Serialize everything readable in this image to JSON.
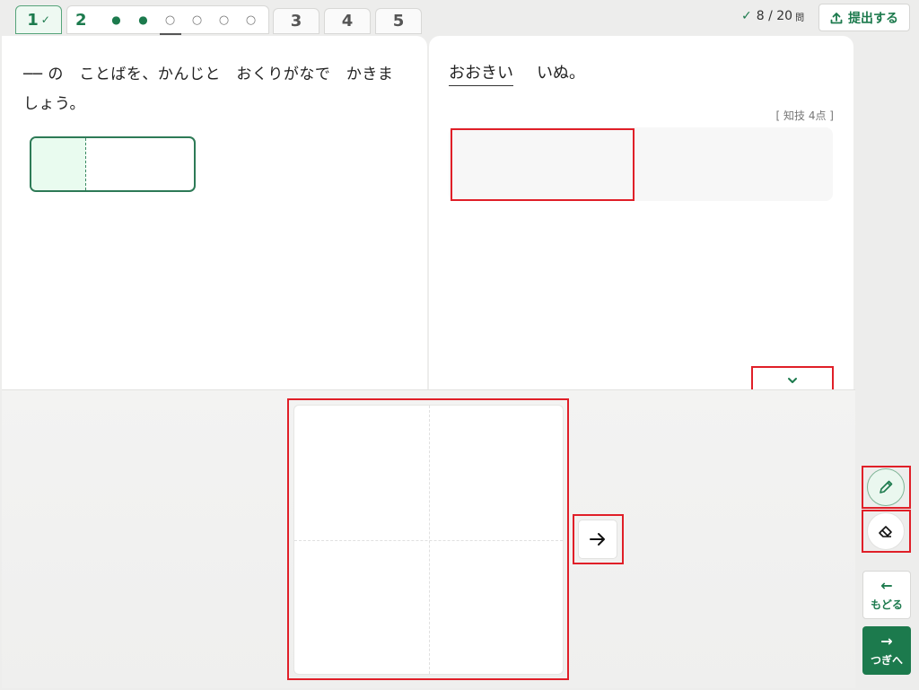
{
  "tabs": {
    "tab1_label": "1",
    "tab1_check": "✓",
    "tab2_label": "2",
    "tab3_label": "3",
    "tab4_label": "4",
    "tab5_label": "5",
    "tab2_subitems": [
      {
        "state": "answered",
        "glyph": "●"
      },
      {
        "state": "answered",
        "glyph": "●"
      },
      {
        "state": "current",
        "glyph": "○"
      },
      {
        "state": "unanswered",
        "glyph": "○"
      },
      {
        "state": "unanswered",
        "glyph": "○"
      },
      {
        "state": "unanswered",
        "glyph": "○"
      }
    ]
  },
  "header": {
    "progress_check": "✓",
    "progress_text": "8 / 20",
    "progress_unit": "問",
    "submit_label": "提出する"
  },
  "left": {
    "instruction": "── の　ことばを、かんじと　おくりがなで　かきましょう。"
  },
  "right": {
    "question_underlined": "おおきい",
    "question_rest": "いぬ。",
    "points": "[ 知技 4点 ]",
    "collapse_icon": "chevron-down-icon"
  },
  "writing": {
    "next_cell_icon": "arrow-right-icon"
  },
  "tools": {
    "pen_icon": "pencil-icon",
    "eraser_icon": "eraser-icon"
  },
  "nav": {
    "back_arrow": "←",
    "back_label": "もどる",
    "next_arrow": "→",
    "next_label": "つぎへ"
  },
  "colors": {
    "accent": "#1c7a4d",
    "highlight": "#e01f28",
    "answer_cell_fill": "#e9fbef"
  }
}
